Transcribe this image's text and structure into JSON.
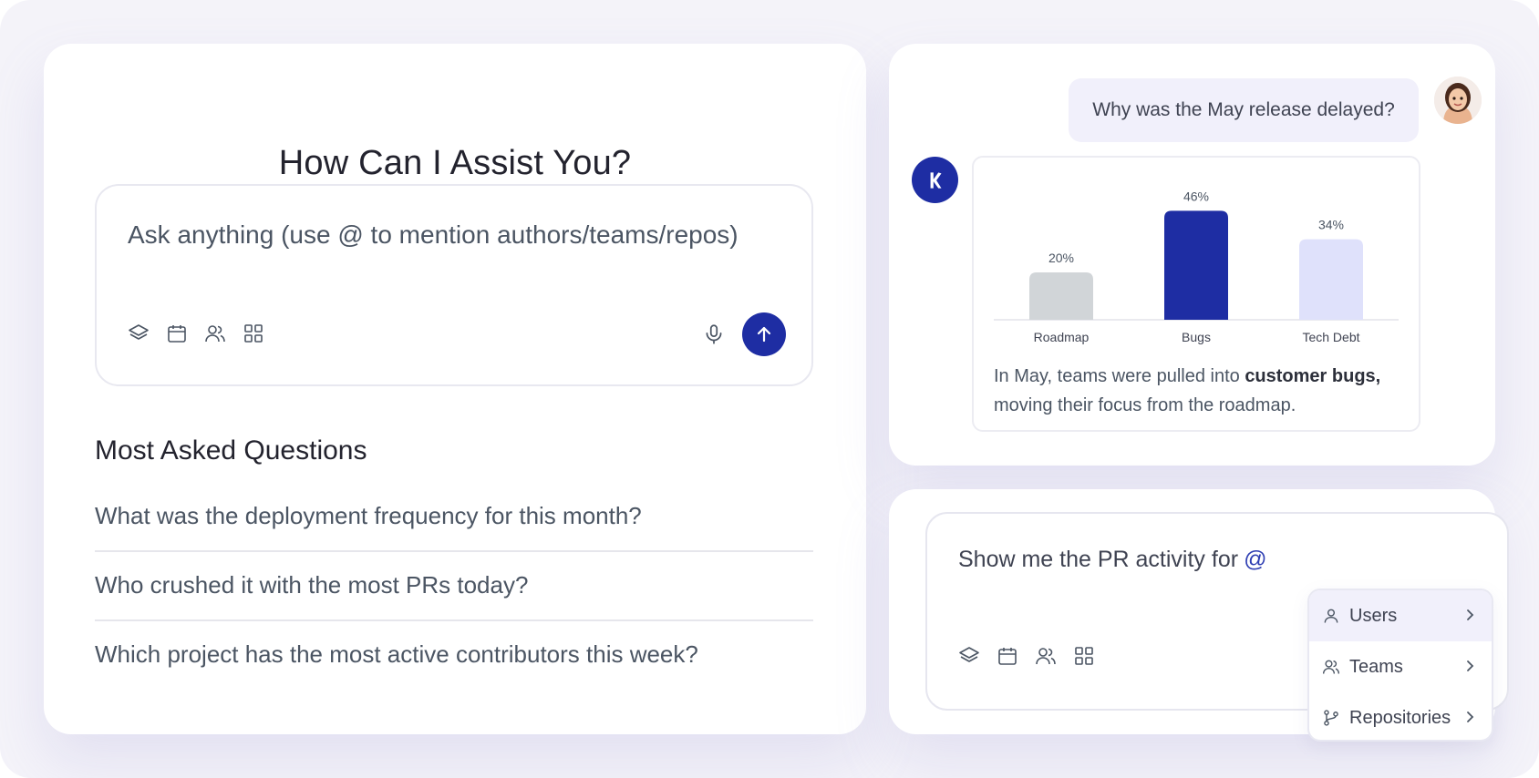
{
  "left_panel": {
    "title": "How Can I Assist You?",
    "prompt": {
      "placeholder": "Ask anything (use @ to mention authors/teams/repos)",
      "tools": [
        "layers-icon",
        "calendar-icon",
        "users-icon",
        "grid-icon"
      ],
      "mic": "microphone-icon",
      "send": "arrow-up-icon"
    },
    "faq": {
      "title": "Most Asked Questions",
      "items": [
        "What was the deployment frequency for this month?",
        "Who crushed it with the most PRs today?",
        "Which project has the most active contributors this week?"
      ]
    }
  },
  "chat": {
    "user_message": "Why was the May release delayed?",
    "answer": {
      "text_before": "In May, teams were pulled into ",
      "text_bold": "customer bugs,",
      "text_after": "moving their focus from the roadmap."
    }
  },
  "chart_data": {
    "type": "bar",
    "categories": [
      "Roadmap",
      "Bugs",
      "Tech Debt"
    ],
    "values": [
      20,
      46,
      34
    ],
    "value_labels": [
      "20%",
      "46%",
      "34%"
    ],
    "colors": [
      "#d1d5d8",
      "#1e2da3",
      "#dfe1fb"
    ],
    "title": "",
    "xlabel": "",
    "ylabel": "",
    "ylim": [
      0,
      50
    ],
    "grid": false
  },
  "compose": {
    "text": "Show me the PR activity for",
    "mention_trigger": "@",
    "menu": [
      {
        "label": "Users",
        "icon": "user-icon",
        "active": true
      },
      {
        "label": "Teams",
        "icon": "users-icon",
        "active": false
      },
      {
        "label": "Repositories",
        "icon": "git-branch-icon",
        "active": false
      }
    ]
  },
  "colors": {
    "accent": "#1e2da3",
    "background": "#f4f3f9",
    "bubble": "#f1f0fb"
  }
}
